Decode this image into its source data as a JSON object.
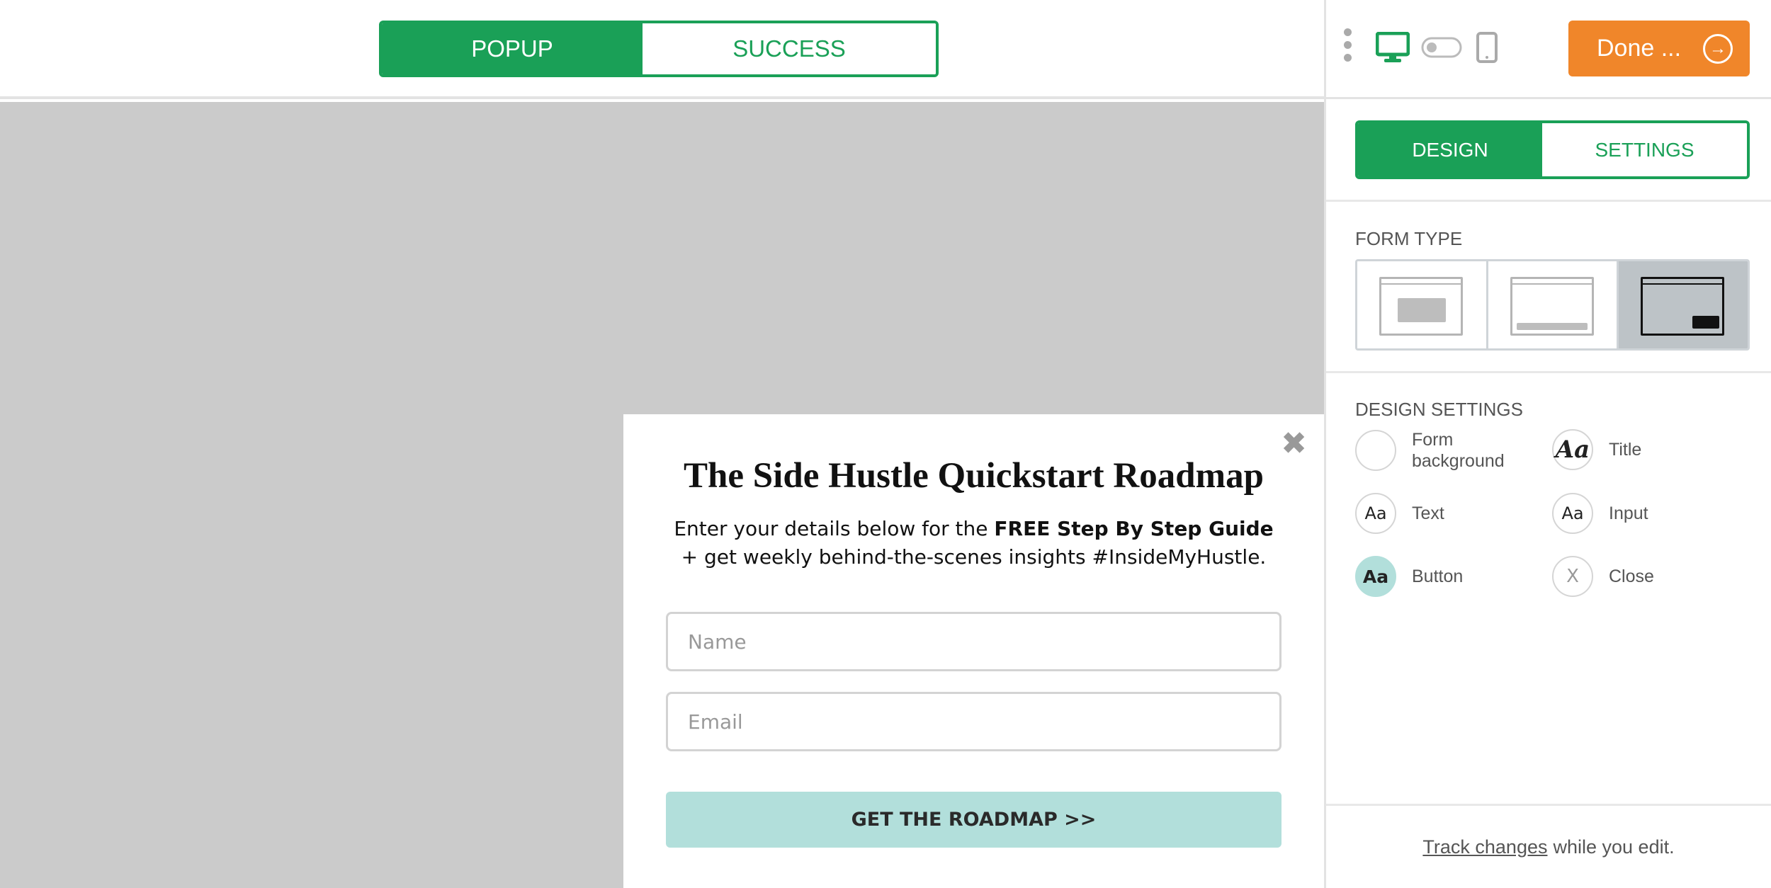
{
  "toolbar": {
    "popup_tab": "POPUP",
    "success_tab": "SUCCESS",
    "active_tab": "POPUP"
  },
  "popup": {
    "close_glyph": "✖",
    "title": "The Side Hustle Quickstart Roadmap",
    "text_prefix": "Enter your details below for the ",
    "text_bold": "FREE Step By Step Guide",
    "text_line2": "+ get weekly behind-the-scenes insights #InsideMyHustle.",
    "name_placeholder": "Name",
    "email_placeholder": "Email",
    "button_label": "GET THE ROADMAP >>",
    "button_color": "#b2dfdb"
  },
  "panel": {
    "done_label": "Done ...",
    "done_color": "#f0862a",
    "accent_color": "#1aa057",
    "tabs": {
      "design": "DESIGN",
      "settings": "SETTINGS",
      "active": "DESIGN"
    },
    "form_type": {
      "label": "FORM TYPE",
      "options": [
        "modal-popup",
        "bottom-bar",
        "slide-in"
      ],
      "selected": "slide-in"
    },
    "design_settings": {
      "label": "DESIGN SETTINGS",
      "items": [
        {
          "label": "Form background",
          "glyph": "",
          "icon": "blank-circle"
        },
        {
          "label": "Title",
          "glyph": "Aa",
          "icon": "serif-aa"
        },
        {
          "label": "Text",
          "glyph": "Aa",
          "icon": "sans-aa"
        },
        {
          "label": "Input",
          "glyph": "Aa",
          "icon": "sans-aa"
        },
        {
          "label": "Button",
          "glyph": "Aa",
          "icon": "bold-aa"
        },
        {
          "label": "Close",
          "glyph": "X",
          "icon": "x"
        }
      ]
    },
    "footer": {
      "link": "Track changes",
      "text": "while you edit."
    }
  }
}
